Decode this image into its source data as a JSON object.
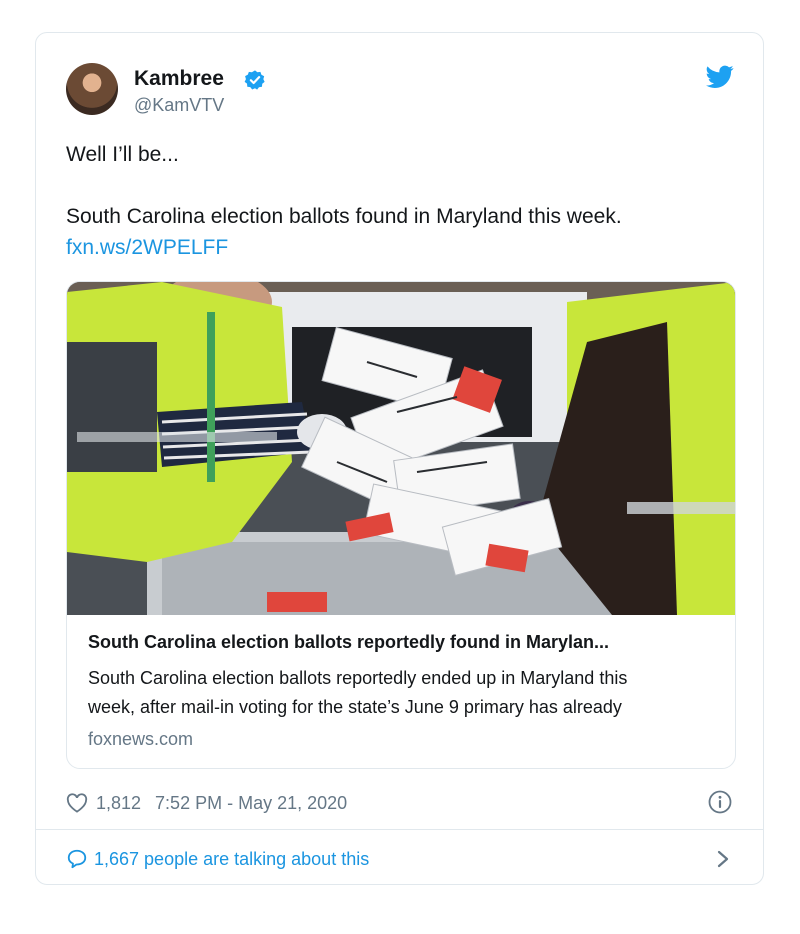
{
  "tweet": {
    "display_name": "Kambree",
    "handle": "@KamVTV",
    "text_line1": "Well I’ll be...",
    "text_line2": "South Carolina election ballots found in Maryland this week.",
    "link_text": "fxn.ws/2WPELFF",
    "likes": "1,812",
    "timestamp": "7:52 PM - May 21, 2020",
    "talking": "1,667 people are talking about this"
  },
  "card": {
    "title": "South Carolina election ballots reportedly found in Marylan...",
    "description_line1": "South Carolina election ballots reportedly ended up in Maryland this",
    "description_line2": "week, after mail-in voting for the state’s June 9 primary has already",
    "domain": "foxnews.com"
  },
  "icons": {
    "verified": "verified-badge-icon",
    "brand": "twitter-bird-icon",
    "like": "heart-icon",
    "info": "info-icon",
    "reply": "speech-bubble-icon",
    "more": "chevron-right-icon"
  },
  "colors": {
    "accent": "#1b95e0",
    "muted": "#657786",
    "text": "#14171a",
    "border": "#e1e8ed"
  }
}
